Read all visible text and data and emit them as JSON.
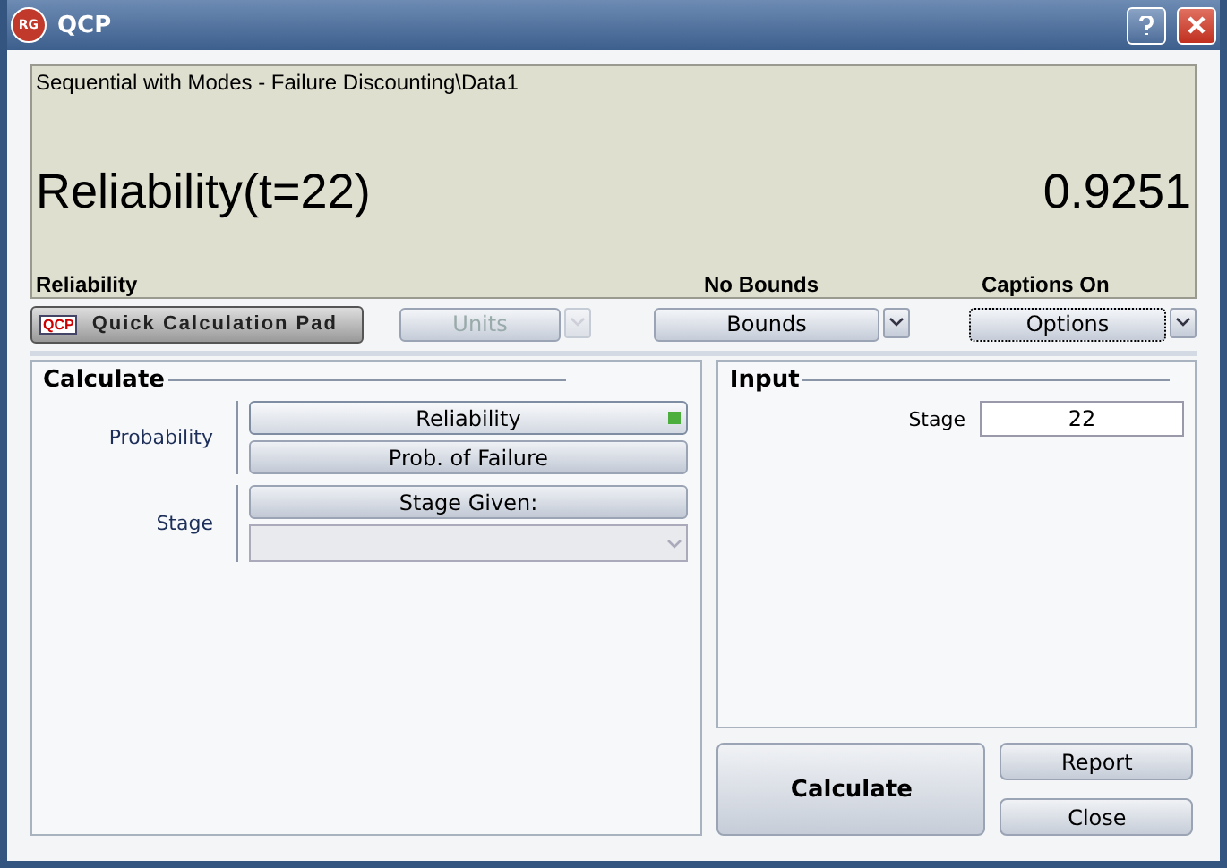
{
  "window": {
    "title": "QCP",
    "logo": "RG"
  },
  "display": {
    "path": "Sequential with Modes - Failure Discounting\\Data1",
    "expression": "Reliability(t=22)",
    "value": "0.9251",
    "captions": [
      "Reliability",
      "No Bounds",
      "Captions On"
    ]
  },
  "toolbar": {
    "pad_button": {
      "icon_text": "QCP",
      "label": "Quick Calculation Pad"
    },
    "dropdowns": [
      {
        "label": "Units",
        "disabled": true,
        "focused": false
      },
      {
        "label": "Bounds",
        "disabled": false,
        "focused": false
      },
      {
        "label": "Options",
        "disabled": false,
        "focused": true
      }
    ]
  },
  "calculate": {
    "title": "Calculate",
    "groups": [
      {
        "label": "Probability",
        "options": [
          {
            "label": "Reliability",
            "selected": true
          },
          {
            "label": "Prob. of Failure",
            "selected": false
          }
        ]
      },
      {
        "label": "Stage",
        "options": [
          {
            "label": "Stage Given:",
            "selected": false
          }
        ],
        "select": {
          "disabled": true
        }
      }
    ]
  },
  "input": {
    "title": "Input",
    "fields": [
      {
        "label": "Stage",
        "value": "22"
      }
    ]
  },
  "actions": {
    "primary": "Calculate",
    "secondary": [
      "Report",
      "Close"
    ]
  }
}
